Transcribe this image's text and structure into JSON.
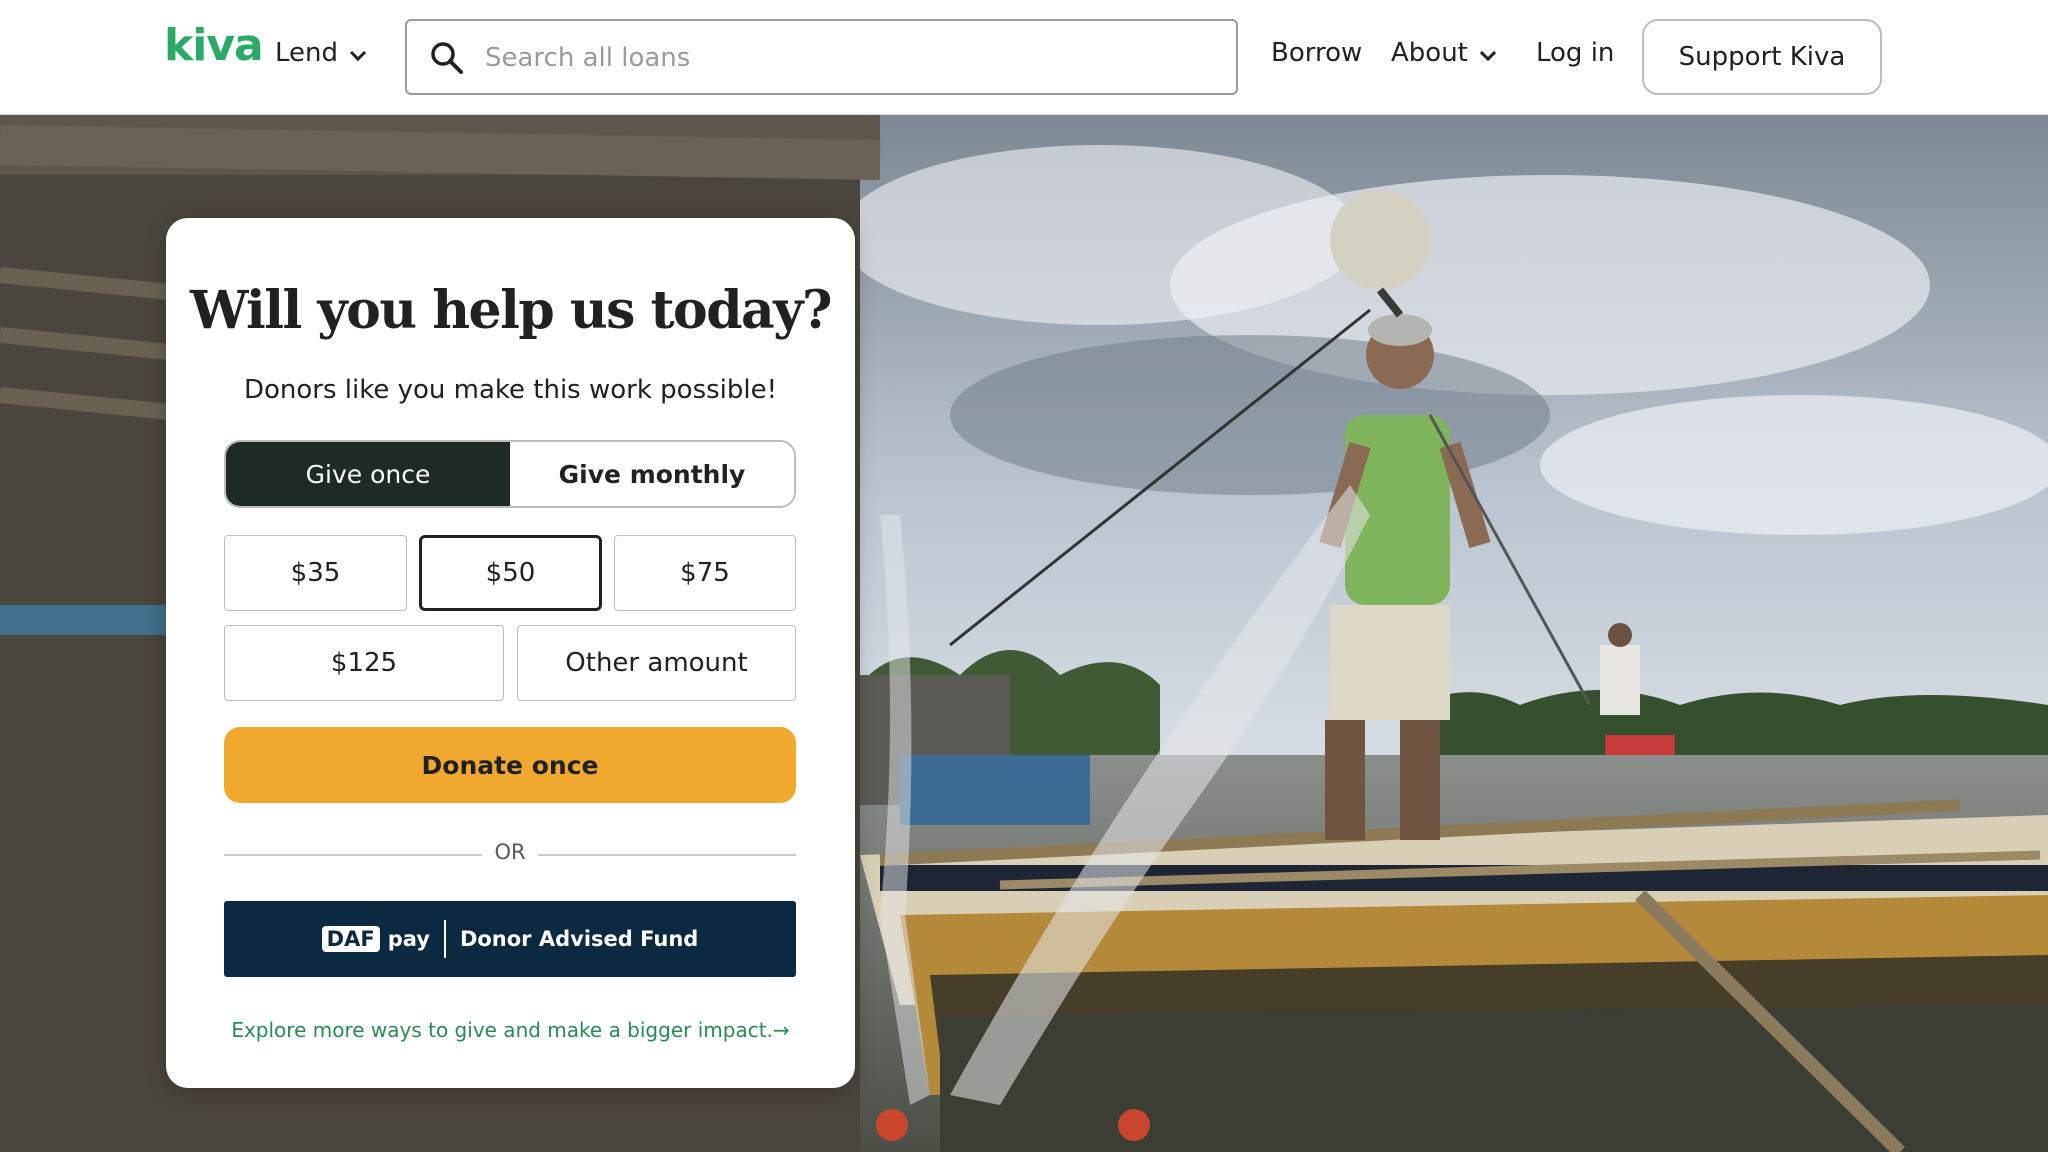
{
  "header": {
    "logo": "kiva",
    "nav": {
      "lend": "Lend",
      "borrow": "Borrow",
      "about": "About",
      "login": "Log in",
      "support": "Support Kiva"
    },
    "search": {
      "placeholder": "Search all loans",
      "value": ""
    }
  },
  "hero": {
    "image_description": ""
  },
  "donation_card": {
    "title": "Will you help us today?",
    "subtitle": "Donors like you make this work possible!",
    "frequency_options": [
      "Give once",
      "Give monthly"
    ],
    "selected_frequency": "Give once",
    "amounts": [
      "$35",
      "$50",
      "$75",
      "$125",
      "Other amount"
    ],
    "selected_amount": "$50",
    "donate_label": "Donate once",
    "or_label": "OR",
    "daf": {
      "logo_text": "DAF",
      "pay_text": "pay",
      "label": "Donor Advised Fund"
    },
    "explore_link": "Explore more ways to give and make a bigger impact.→"
  },
  "colors": {
    "brand_green": "#2aa967",
    "toggle_active": "#1d2b23",
    "donate_button": "#f0a92e",
    "daf_button": "#0b2a41",
    "link_green": "#2a8a56"
  },
  "icons": [
    "search-icon",
    "chevron-down-icon"
  ]
}
